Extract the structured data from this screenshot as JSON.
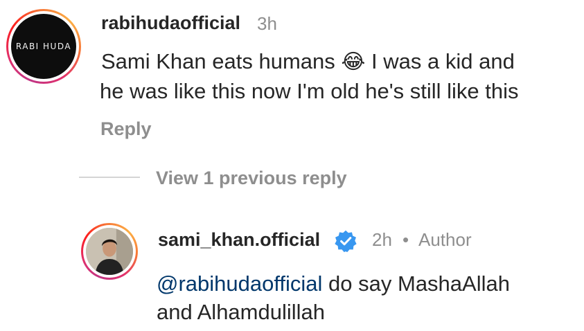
{
  "comment": {
    "username": "rabihudaofficial",
    "time": "3h",
    "avatar_logo_text": "RABI HUDA",
    "line1_before": "Sami Khan eats humans ",
    "emoji": "😂",
    "line1_after": " I was a kid and",
    "line2": "he was like this now I'm old he's still like this",
    "reply_label": "Reply"
  },
  "view_replies_label": "View 1 previous reply",
  "reply": {
    "username": "sami_khan.official",
    "verified_icon": "verified-badge-icon",
    "time": "2h",
    "separator": "•",
    "author_label": "Author",
    "mention": "@rabihudaofficial",
    "line1_after": " do say MashaAllah",
    "line2": "and Alhamdulillah"
  },
  "colors": {
    "text": "#262626",
    "muted": "#8e8e8e",
    "mention": "#00376b",
    "verified": "#3897f0"
  }
}
